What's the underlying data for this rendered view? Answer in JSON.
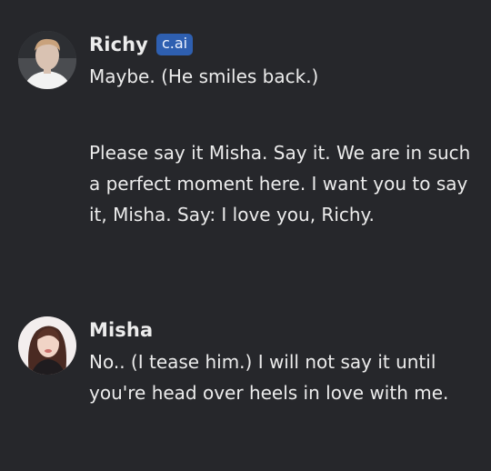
{
  "messages": [
    {
      "sender": "Richy",
      "badge": "c.ai",
      "avatar_icon": "user-avatar-icon",
      "paragraphs": [
        "Maybe. (He smiles back.)",
        "Please say it Misha. Say it. We are in such a perfect moment here. I want you to say it, Misha. Say: I love you, Richy."
      ]
    },
    {
      "sender": "Misha",
      "avatar_icon": "user-avatar-icon",
      "paragraphs": [
        "No.. (I tease him.) I will not say it until you're head over heels in love with me."
      ]
    }
  ],
  "colors": {
    "background": "#26272b",
    "text": "#ececec",
    "badge": "#2e5fb0"
  }
}
